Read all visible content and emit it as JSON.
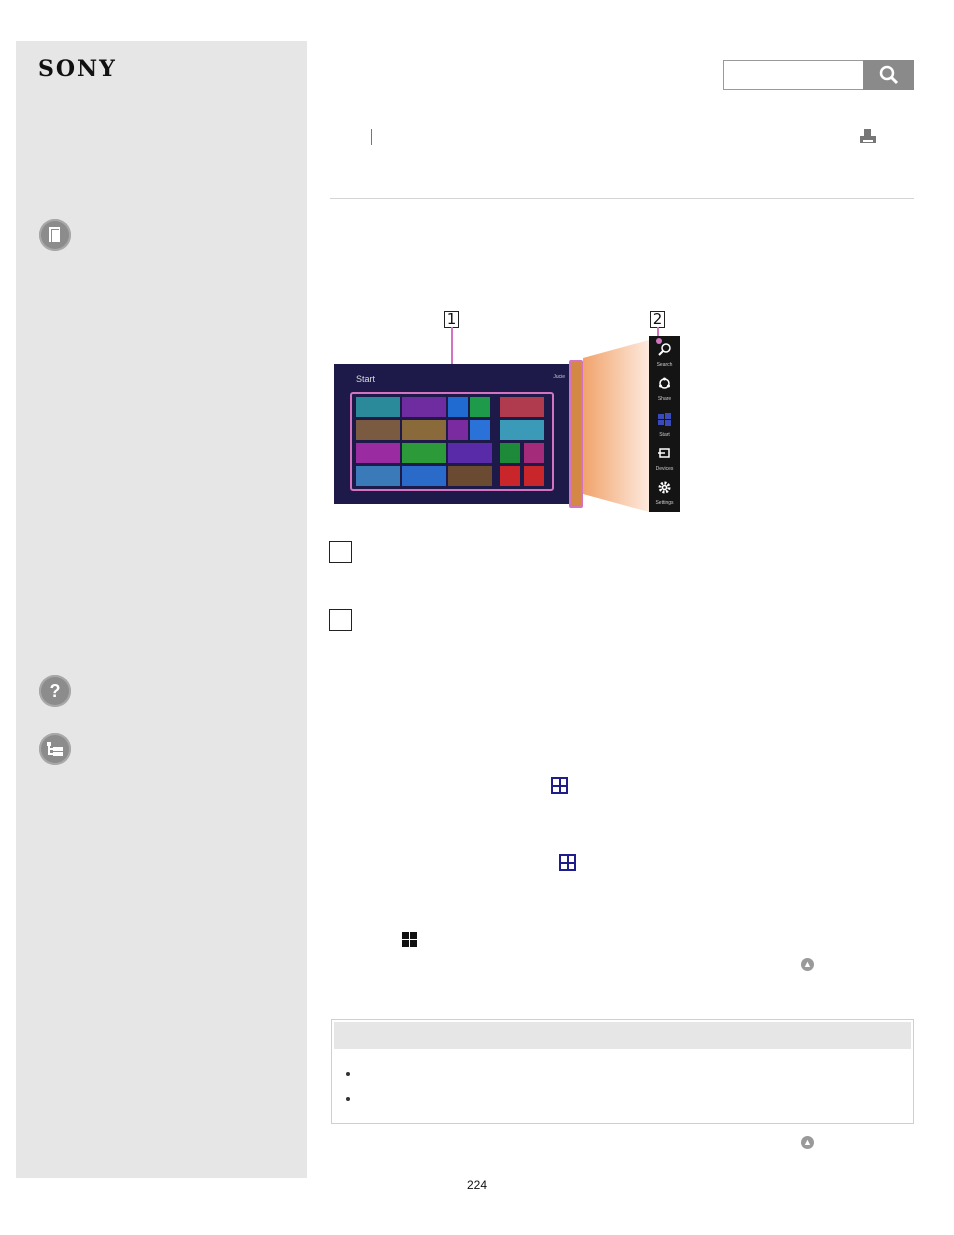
{
  "brand": {
    "logo": "SONY"
  },
  "sidebar": {
    "icons": [
      {
        "name": "manual-book-icon",
        "glyph": ""
      },
      {
        "name": "help-question-icon",
        "glyph": "?"
      },
      {
        "name": "contents-tree-icon",
        "glyph": ""
      }
    ]
  },
  "search": {
    "placeholder": "",
    "value": ""
  },
  "figure": {
    "callout_1": "1",
    "callout_2": "2",
    "screen_title": "Start",
    "screen_user": "Jucie",
    "charms": [
      {
        "label": "Search",
        "icon": "search-icon"
      },
      {
        "label": "Share",
        "icon": "share-icon"
      },
      {
        "label": "Start",
        "icon": "windows-icon"
      },
      {
        "label": "Devices",
        "icon": "devices-icon"
      },
      {
        "label": "Settings",
        "icon": "gear-icon"
      }
    ]
  },
  "colors": {
    "highlight": "#d474c0",
    "start_screen_bg": "#1d1a4a",
    "windows_blue": "#1f1c8c"
  },
  "footer": {
    "page_number": "224"
  }
}
